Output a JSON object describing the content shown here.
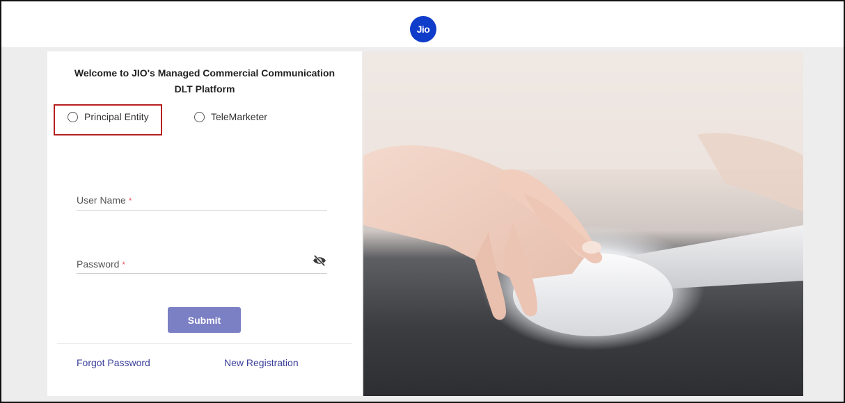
{
  "header": {
    "logo_text": "Jio",
    "brand_color": "#0f3cc9"
  },
  "login": {
    "welcome_line1": "Welcome to JIO's Managed Commercial Communication",
    "welcome_line2": "DLT Platform",
    "role_options": [
      {
        "label": "Principal Entity",
        "selected": false,
        "highlighted": true
      },
      {
        "label": "TeleMarketer",
        "selected": false,
        "highlighted": false
      }
    ],
    "username": {
      "label": "User Name",
      "required_mark": "*",
      "value": ""
    },
    "password": {
      "label": "Password",
      "required_mark": "*",
      "value": "",
      "toggle_icon": "eye-slash-icon"
    },
    "submit_label": "Submit",
    "submit_color": "#7b7fc4",
    "forgot_password_label": "Forgot Password",
    "new_registration_label": "New Registration",
    "highlight_color": "#b61f1f"
  },
  "hero_image": {
    "description": "hand-on-mouse-photo"
  }
}
